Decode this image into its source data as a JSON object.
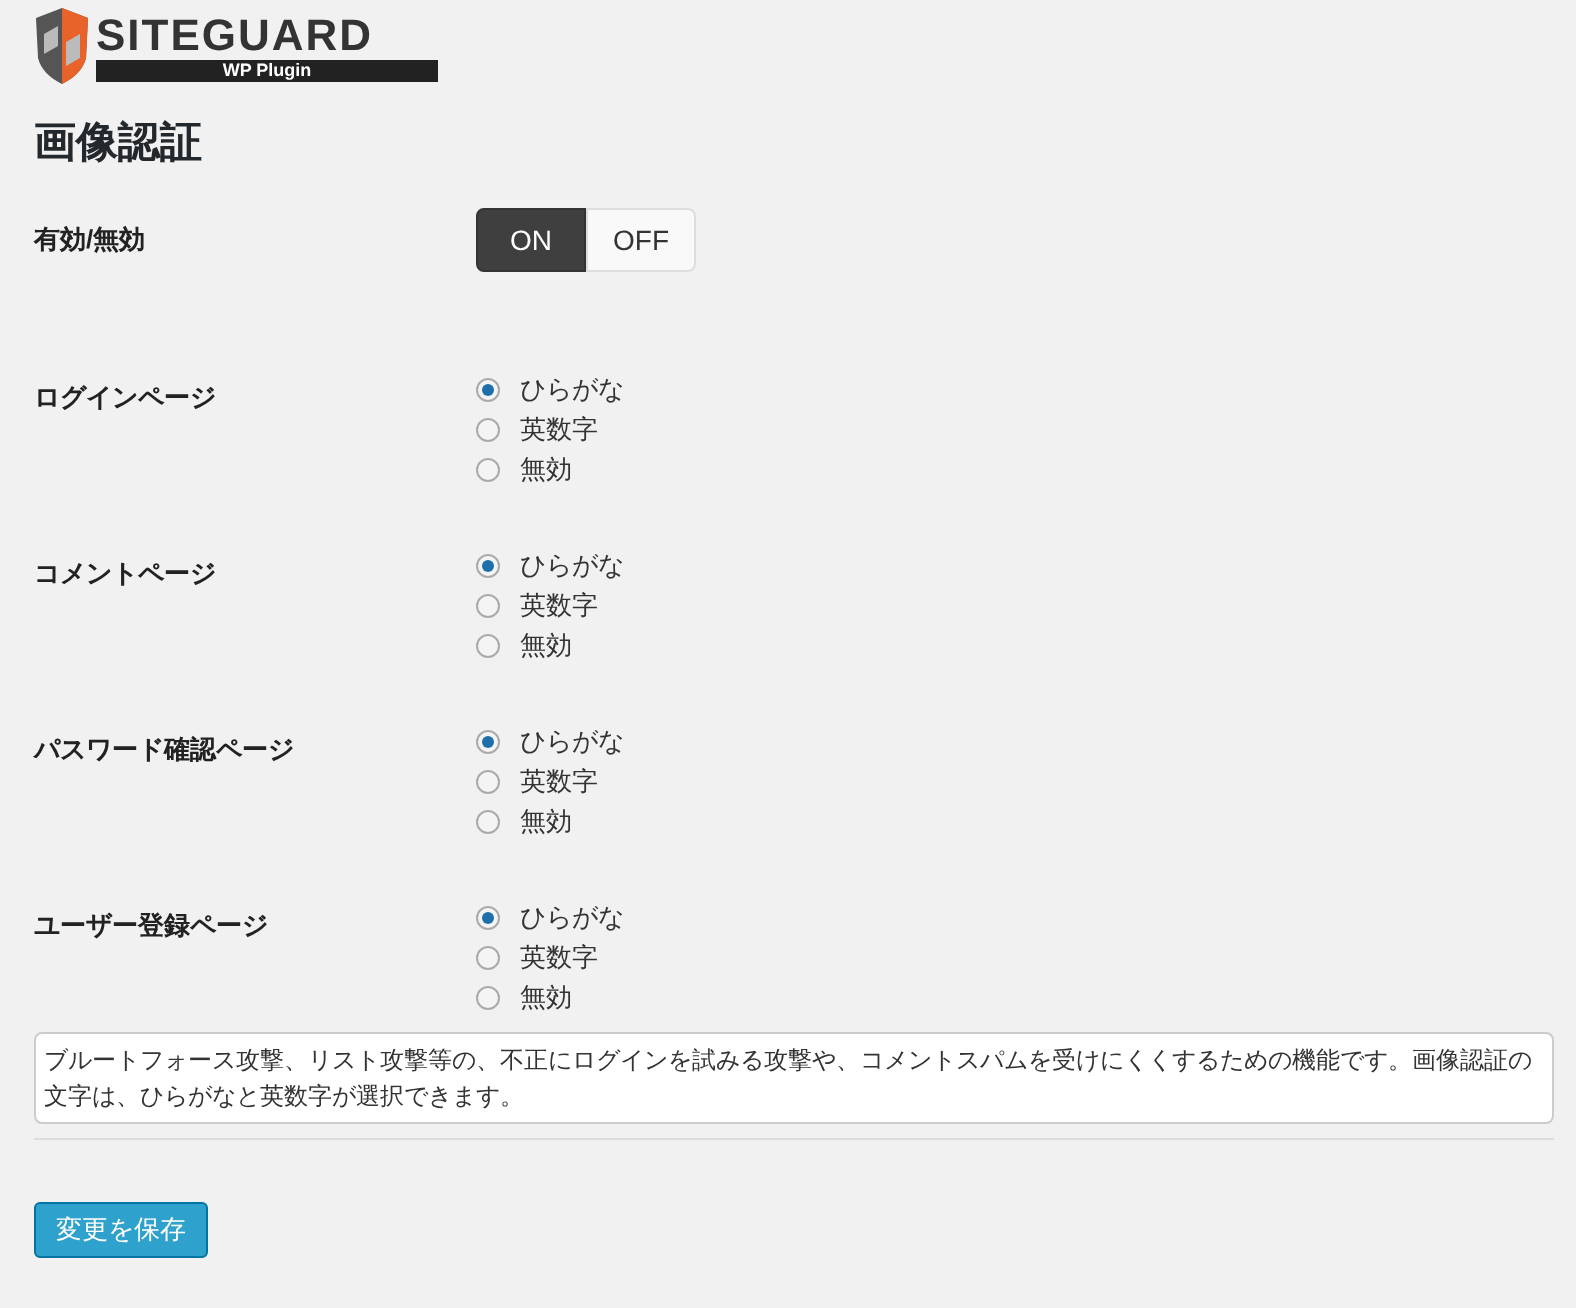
{
  "logo": {
    "name": "SITEGUARD",
    "tagline": "WP Plugin"
  },
  "title": "画像認証",
  "settings": [
    {
      "kind": "toggle",
      "label": "有効/無効",
      "options": [
        {
          "label": "ON",
          "selected": true
        },
        {
          "label": "OFF",
          "selected": false
        }
      ]
    },
    {
      "kind": "radio",
      "label": "ログインページ",
      "options": [
        {
          "label": "ひらがな",
          "selected": true
        },
        {
          "label": "英数字",
          "selected": false
        },
        {
          "label": "無効",
          "selected": false
        }
      ]
    },
    {
      "kind": "radio",
      "label": "コメントページ",
      "options": [
        {
          "label": "ひらがな",
          "selected": true
        },
        {
          "label": "英数字",
          "selected": false
        },
        {
          "label": "無効",
          "selected": false
        }
      ]
    },
    {
      "kind": "radio",
      "label": "パスワード確認ページ",
      "options": [
        {
          "label": "ひらがな",
          "selected": true
        },
        {
          "label": "英数字",
          "selected": false
        },
        {
          "label": "無効",
          "selected": false
        }
      ]
    },
    {
      "kind": "radio",
      "label": "ユーザー登録ページ",
      "options": [
        {
          "label": "ひらがな",
          "selected": true
        },
        {
          "label": "英数字",
          "selected": false
        },
        {
          "label": "無効",
          "selected": false
        }
      ]
    }
  ],
  "description": "ブルートフォース攻撃、リスト攻撃等の、不正にログインを試みる攻撃や、コメントスパムを受けにくくするための機能です。画像認証の文字は、ひらがなと英数字が選択できます。",
  "save_button": "変更を保存"
}
